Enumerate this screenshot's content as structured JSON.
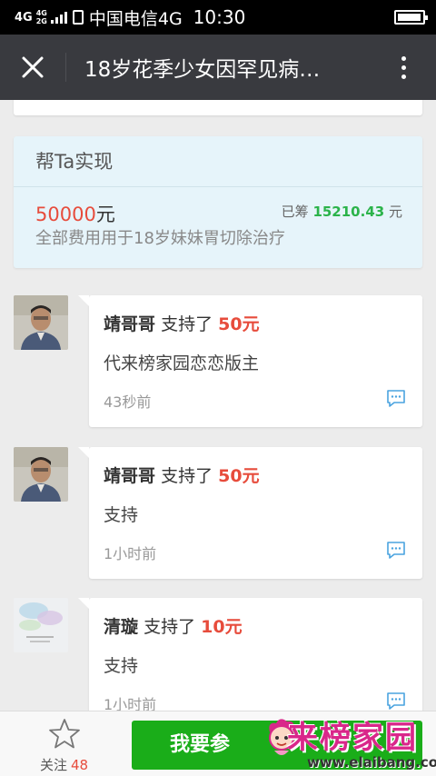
{
  "status_bar": {
    "network": "4G",
    "network_small_top": "4G",
    "network_small_bottom": "2G",
    "carrier": "中国电信4G",
    "time": "10:30"
  },
  "nav": {
    "title": "18岁花季少女因罕见病…"
  },
  "goal": {
    "title": "帮Ta实现",
    "amount": "50000",
    "amount_unit": "元",
    "raised_label": "已筹",
    "raised_amount": "15210.43",
    "raised_unit": "元",
    "description": "全部费用用于18岁妹妹胃切除治疗"
  },
  "comments": [
    {
      "name": "靖哥哥",
      "action": "支持了",
      "amount": "50元",
      "text": "代来榜家园恋恋版主",
      "time": "43秒前"
    },
    {
      "name": "靖哥哥",
      "action": "支持了",
      "amount": "50元",
      "text": "支持",
      "time": "1小时前"
    },
    {
      "name": "清璇",
      "action": "支持了",
      "amount": "10元",
      "text": "支持",
      "time": "1小时前"
    }
  ],
  "bottom": {
    "follow_label": "关注",
    "follow_count": "48",
    "support_button": "我要参"
  },
  "watermark": {
    "text": "来榜家园",
    "url": "www.elaibang.com"
  },
  "colors": {
    "accent_green": "#1aad19",
    "amount_red": "#e74c3c",
    "raised_green": "#2bb34a",
    "nav_bg": "#393a3f"
  }
}
